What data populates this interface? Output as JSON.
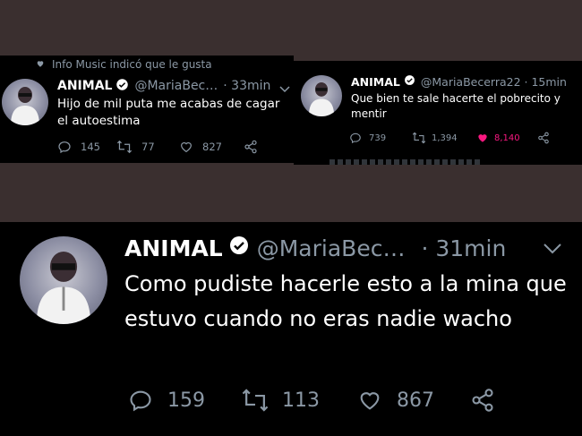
{
  "colors": {
    "background": "#3a2f2f",
    "card": "#000000",
    "muted": "#8b98a5",
    "like_active": "#f91880"
  },
  "tweet1": {
    "liked_by": "Info Music indicó que le gusta",
    "name": "ANIMAL",
    "handle": "@MariaBec…",
    "time": "· 33min",
    "text": "Hijo de mil puta me acabas de cagar el autoestima",
    "replies": "145",
    "retweets": "77",
    "likes": "827"
  },
  "tweet2": {
    "name": "ANIMAL",
    "handle": "@MariaBecerra22 · 15min",
    "text": "Que bien te sale hacerte el pobrecito y mentir",
    "replies": "739",
    "retweets": "1,394",
    "likes": "8,140"
  },
  "tweet3": {
    "name": "ANIMAL",
    "handle": "@MariaBec…",
    "time": "· 31min",
    "text": "Como pudiste hacerle esto a la mina que estuvo cuando no eras nadie wacho",
    "replies": "159",
    "retweets": "113",
    "likes": "867"
  }
}
